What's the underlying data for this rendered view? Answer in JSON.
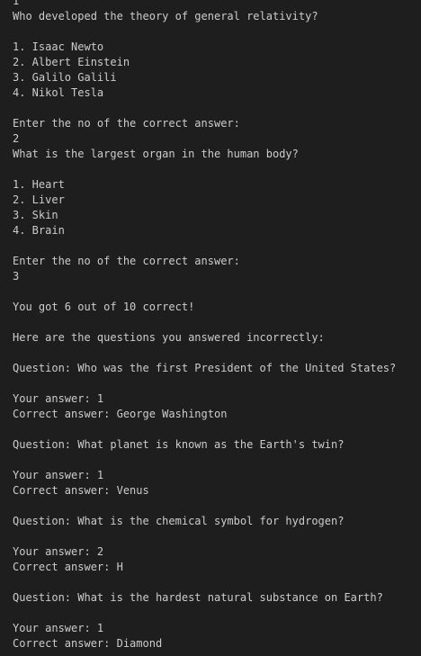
{
  "terminal": {
    "lines": [
      "1",
      "Who developed the theory of general relativity?",
      "",
      "1. Isaac Newto",
      "2. Albert Einstein",
      "3. Galilo Galili",
      "4. Nikol Tesla",
      "",
      "Enter the no of the correct answer:",
      "2",
      "What is the largest organ in the human body?",
      "",
      "1. Heart",
      "2. Liver",
      "3. Skin",
      "4. Brain",
      "",
      "Enter the no of the correct answer:",
      "3",
      "",
      "You got 6 out of 10 correct!",
      "",
      "Here are the questions you answered incorrectly:",
      "",
      "Question: Who was the first President of the United States?",
      "",
      "Your answer: 1",
      "Correct answer: George Washington",
      "",
      "Question: What planet is known as the Earth's twin?",
      "",
      "Your answer: 1",
      "Correct answer: Venus",
      "",
      "Question: What is the chemical symbol for hydrogen?",
      "",
      "Your answer: 2",
      "Correct answer: H",
      "",
      "Question: What is the hardest natural substance on Earth?",
      "",
      "Your answer: 1",
      "Correct answer: Diamond"
    ],
    "prompt": ""
  }
}
